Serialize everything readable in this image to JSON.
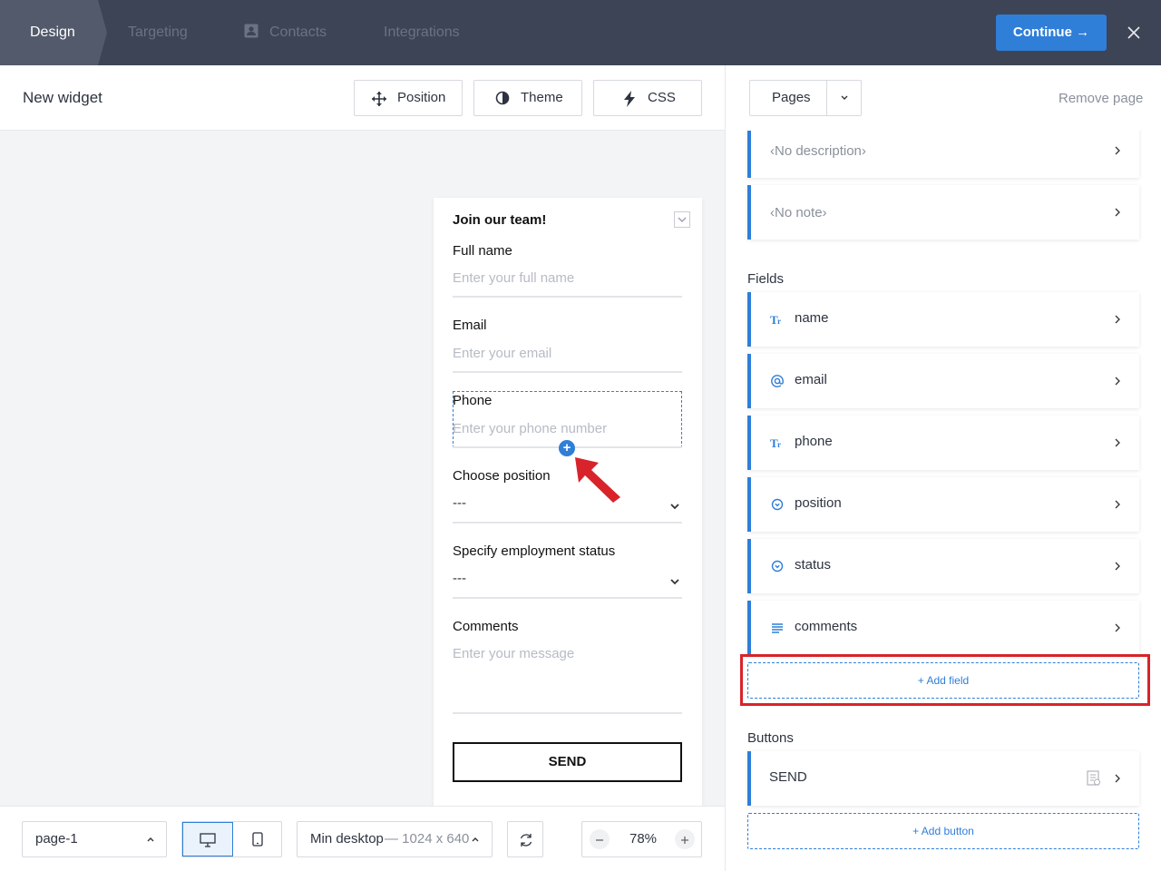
{
  "nav": {
    "tabs": [
      "Design",
      "Targeting",
      "Contacts",
      "Integrations"
    ],
    "continue_label": "Continue →"
  },
  "toolbar": {
    "widget_title": "New widget",
    "position_label": "Position",
    "theme_label": "Theme",
    "css_label": "CSS"
  },
  "form": {
    "title": "Join our team!",
    "full_name_label": "Full name",
    "full_name_placeholder": "Enter your full name",
    "email_label": "Email",
    "email_placeholder": "Enter your email",
    "phone_label": "Phone",
    "phone_placeholder": "Enter your phone number",
    "position_label": "Choose position",
    "position_value": "---",
    "status_label": "Specify employment status",
    "status_value": "---",
    "comments_label": "Comments",
    "comments_placeholder": "Enter your message",
    "send_label": "SEND"
  },
  "bottombar": {
    "page_select": "page-1",
    "device_label": "Min desktop",
    "device_size": "— 1024 x 640",
    "zoom": "78%"
  },
  "panel": {
    "pages_label": "Pages",
    "remove_page": "Remove page",
    "description": "‹No description›",
    "note": "‹No note›",
    "fields_header": "Fields",
    "fields": [
      {
        "name": "name",
        "icon": "text-type-icon"
      },
      {
        "name": "email",
        "icon": "at-sign-icon"
      },
      {
        "name": "phone",
        "icon": "text-type-icon"
      },
      {
        "name": "position",
        "icon": "dropdown-circle-icon"
      },
      {
        "name": "status",
        "icon": "dropdown-circle-icon"
      },
      {
        "name": "comments",
        "icon": "paragraph-lines-icon"
      }
    ],
    "add_field": "+ Add field",
    "buttons_header": "Buttons",
    "button_send": "SEND",
    "add_button": "+ Add button"
  },
  "colors": {
    "accent": "#2f7ed8",
    "topbar": "#3d4456",
    "highlight": "#d8232a"
  }
}
